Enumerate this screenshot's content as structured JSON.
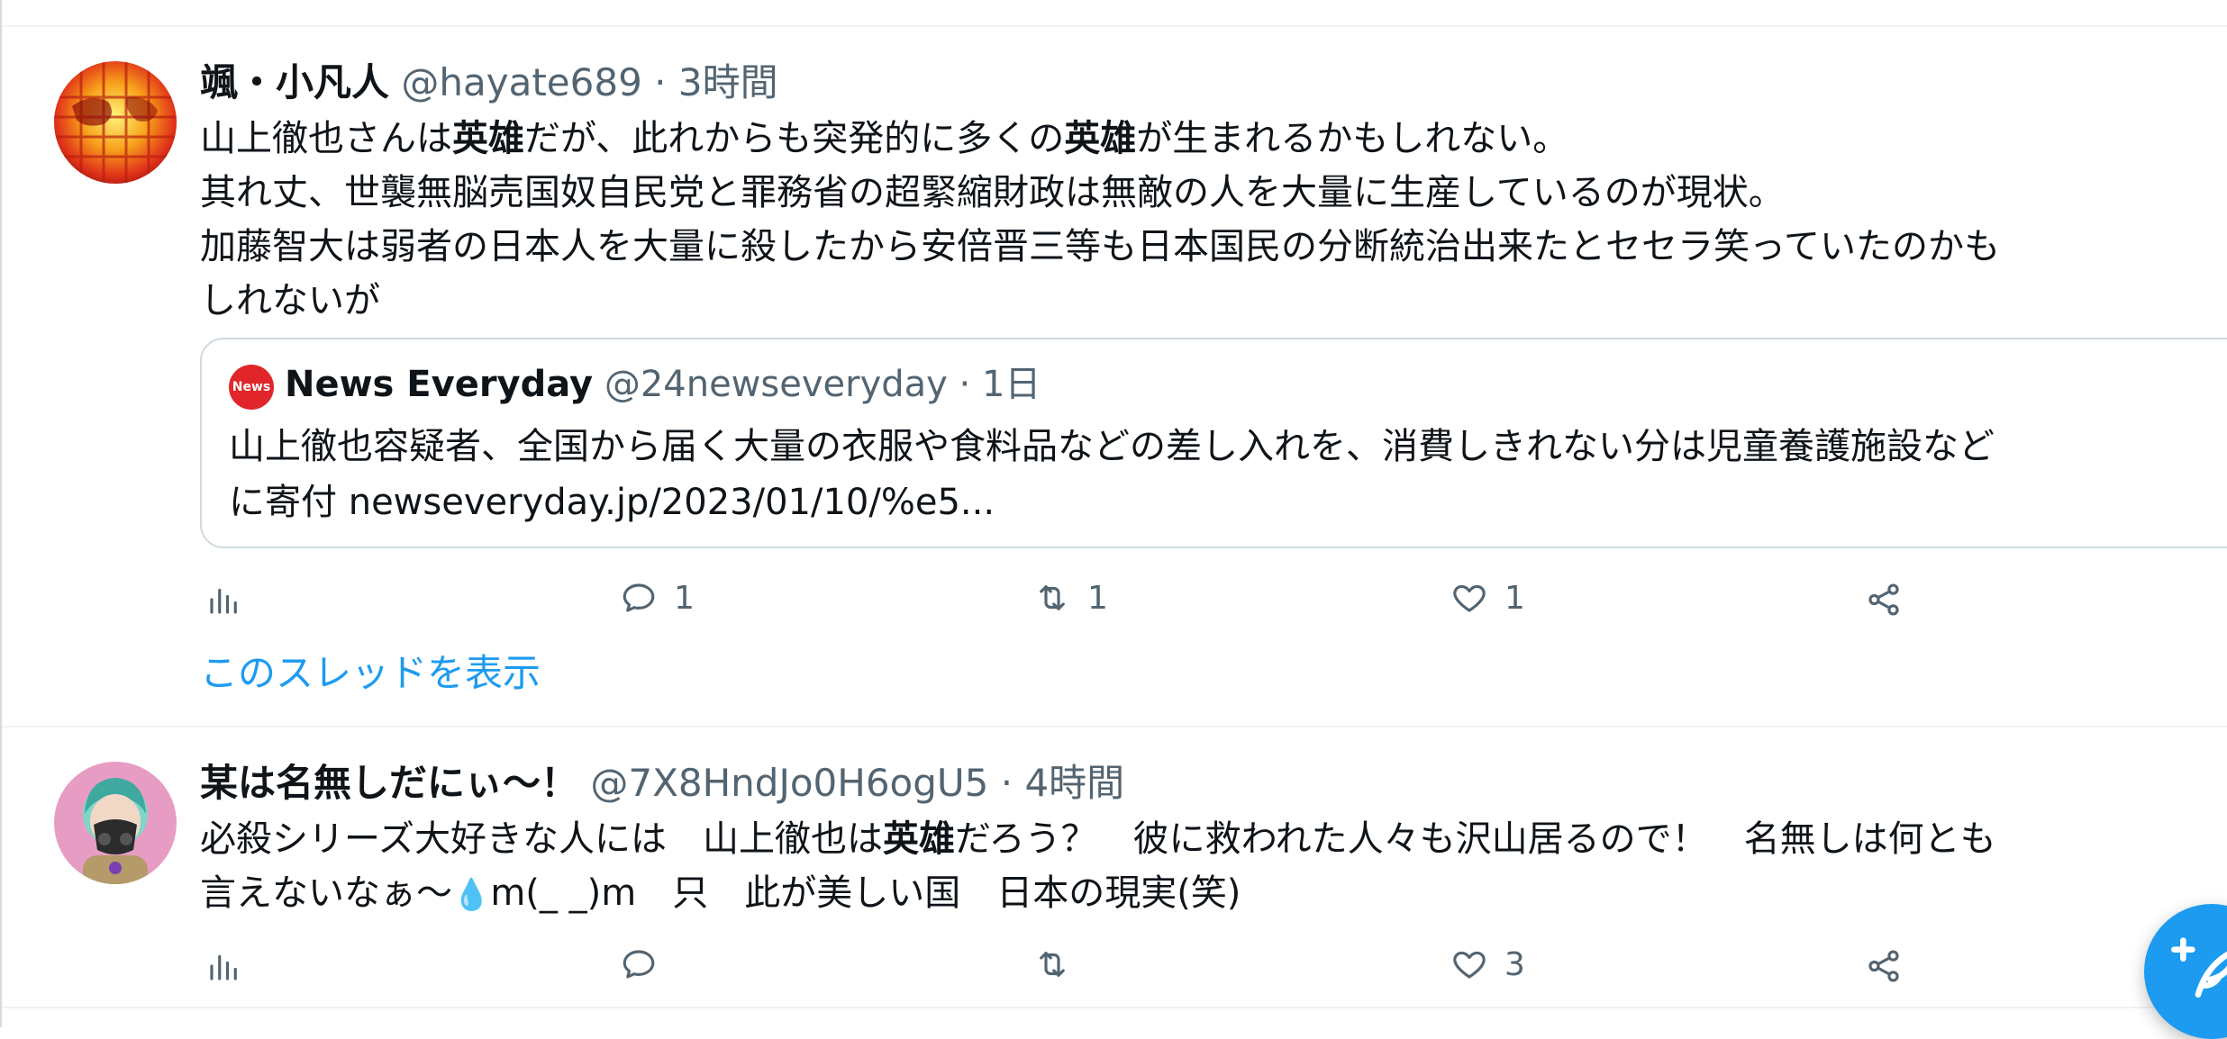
{
  "tweets": [
    {
      "name": "颯・小凡人",
      "handle": "@hayate689",
      "time": "· 3時間",
      "lines": [
        [
          {
            "t": "山上徹也さんは"
          },
          {
            "t": "英雄",
            "b": true
          },
          {
            "t": "だが、此れからも突発的に多くの"
          },
          {
            "t": "英雄",
            "b": true
          },
          {
            "t": "が生まれるかもしれない。"
          }
        ],
        [
          {
            "t": "其れ丈、世襲無脳売国奴自民党と罪務省の超緊縮財政は無敵の人を大量に生産しているのが現状。"
          }
        ],
        [
          {
            "t": "加藤智大は弱者の日本人を大量に殺したから安倍晋三等も日本国民の分断統治出来たとセセラ笑っていたのかも"
          }
        ],
        [
          {
            "t": "しれないが"
          }
        ]
      ],
      "quote": {
        "logo_text": "News",
        "name": "News Everyday",
        "handle": "@24newseveryday",
        "time": "· 1日",
        "line1": "山上徹也容疑者、全国から届く大量の衣服や食料品などの差し入れを、消費しきれない分は児童養護施設など",
        "line2": "に寄付 newseveryday.jp/2023/01/10/%e5..."
      },
      "actions": {
        "reply": "1",
        "retweet": "1",
        "like": "1"
      },
      "thread_link": "このスレッドを表示"
    },
    {
      "name": "某は名無しだにぃ～！",
      "handle": "@7X8HndJo0H6ogU5",
      "time": "· 4時間",
      "lines": [
        [
          {
            "t": "必殺シリーズ大好きな人には　山上徹也は"
          },
          {
            "t": "英雄",
            "b": true
          },
          {
            "t": "だろう？　彼に救われた人々も沢山居るので！　名無しは何とも"
          }
        ],
        [
          {
            "t": "言えないなぁ～"
          },
          {
            "t": "💧",
            "drop": true
          },
          {
            "t": "m(_ _)m　只　此が美しい国　日本の現実(笑)"
          }
        ]
      ],
      "actions": {
        "reply": "",
        "retweet": "",
        "like": "3"
      }
    }
  ],
  "icons": {
    "views": "bar-chart-icon",
    "reply": "speech-bubble-icon",
    "retweet": "retweet-arrows-icon",
    "like": "heart-icon",
    "share": "share-nodes-icon",
    "compose": "feather-plus-icon"
  },
  "colors": {
    "accent": "#1d9bf0",
    "secondary_text": "#536471",
    "news_logo": "#e0262a"
  }
}
